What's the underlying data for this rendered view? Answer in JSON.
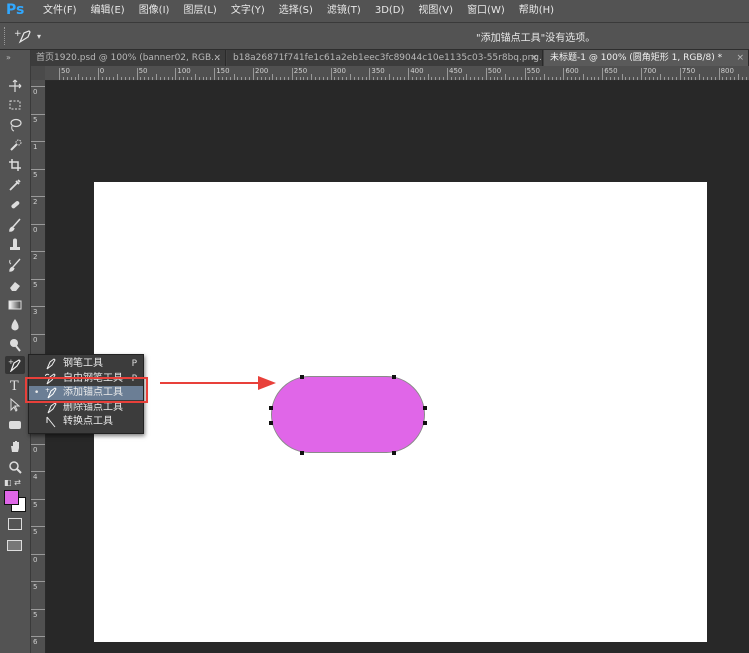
{
  "app": {
    "logo": "Ps"
  },
  "menu": [
    "文件(F)",
    "编辑(E)",
    "图像(I)",
    "图层(L)",
    "文字(Y)",
    "选择(S)",
    "滤镜(T)",
    "3D(D)",
    "视图(V)",
    "窗口(W)",
    "帮助(H)"
  ],
  "options_bar": {
    "status": "\"添加锚点工具\"没有选项。",
    "tool_icon": "add-anchor-pen-icon"
  },
  "tabs": [
    {
      "label": "首页1920.psd @ 100% (banner02, RGB...",
      "close": "×",
      "active": false
    },
    {
      "label": "b18a26871f741fe1c61a2eb1eec3fc89044c10e1135c03-55r8bq.png...",
      "close": "×",
      "active": false
    },
    {
      "label": "未标题-1 @ 100% (圆角矩形 1, RGB/8) *",
      "close": "×",
      "active": true
    }
  ],
  "ruler": {
    "top_labels": [
      "50",
      "0",
      "50",
      "100",
      "150",
      "200",
      "250",
      "300",
      "350",
      "400",
      "450",
      "500",
      "550",
      "600",
      "650",
      "700",
      "750",
      "800"
    ],
    "left_labels": [
      "0",
      "5",
      "1",
      "5",
      "2",
      "0",
      "2",
      "5",
      "3",
      "0",
      "3",
      "5",
      "4",
      "0",
      "4",
      "5",
      "5",
      "0",
      "5",
      "5",
      "6"
    ]
  },
  "toolbar": {
    "tools": [
      "move-icon",
      "marquee-icon",
      "lasso-icon",
      "quick-select-icon",
      "crop-icon",
      "eyedropper-icon",
      "healing-brush-icon",
      "brush-icon",
      "clone-stamp-icon",
      "history-brush-icon",
      "eraser-icon",
      "gradient-icon",
      "blur-icon",
      "dodge-icon",
      "pen-icon",
      "type-icon",
      "path-select-icon",
      "rectangle-icon",
      "hand-icon",
      "zoom-icon"
    ],
    "foreground_color": "#e066e8",
    "background_color": "#ffffff"
  },
  "flyout": {
    "items": [
      {
        "label": "钢笔工具",
        "key": "P",
        "icon": "pen-icon",
        "selected": false
      },
      {
        "label": "自由钢笔工具",
        "key": "P",
        "icon": "freeform-pen-icon",
        "selected": false
      },
      {
        "label": "添加锚点工具",
        "key": "",
        "icon": "add-anchor-point-icon",
        "selected": true,
        "bullet": "•"
      },
      {
        "label": "删除锚点工具",
        "key": "",
        "icon": "delete-anchor-point-icon",
        "selected": false
      },
      {
        "label": "转换点工具",
        "key": "",
        "icon": "convert-point-icon",
        "selected": false
      }
    ]
  },
  "canvas": {
    "background": "#ffffff",
    "shape": {
      "type": "rounded-rectangle",
      "fill": "#e066e8",
      "stroke": "#8a8a8a"
    }
  },
  "annotation": {
    "color": "#e8403a"
  }
}
